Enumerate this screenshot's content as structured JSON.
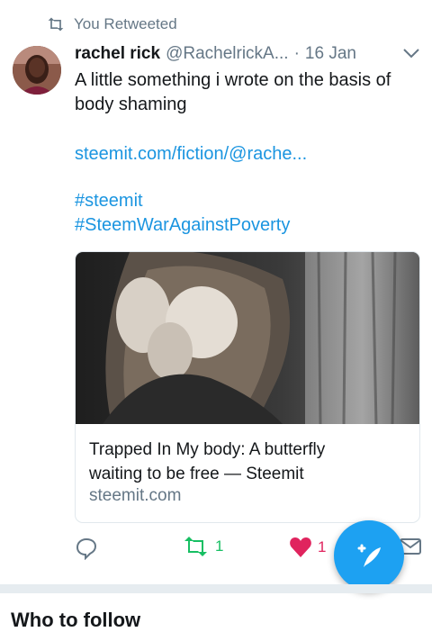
{
  "retweet_bar": {
    "icon": "retweet-icon",
    "label": "You Retweeted"
  },
  "tweet": {
    "author": {
      "name": "rachel rick",
      "handle": "@RachelrickA...",
      "avatar": "profile-photo"
    },
    "separator": "·",
    "date": "16 Jan",
    "text_lines": [
      "A little something i wrote on the basis of",
      "body shaming"
    ],
    "link": "steemit.com/fiction/@rache...",
    "hashtags": [
      "#steemit",
      "#SteemWarAgainstPoverty"
    ]
  },
  "card": {
    "image": "woman-covering-face-photo",
    "title_lines": [
      "Trapped In My body: A butterfly",
      "waiting to be free — Steemit"
    ],
    "domain": "steemit.com"
  },
  "actions": {
    "reply_icon": "reply-icon",
    "retweet_count": "1",
    "like_count": "1",
    "retweet_color": "#17bf63",
    "like_color": "#e0245e"
  },
  "fab": {
    "icon": "compose-tweet-icon",
    "color": "#1da1f2"
  },
  "next_section": {
    "heading": "Who to follow"
  }
}
